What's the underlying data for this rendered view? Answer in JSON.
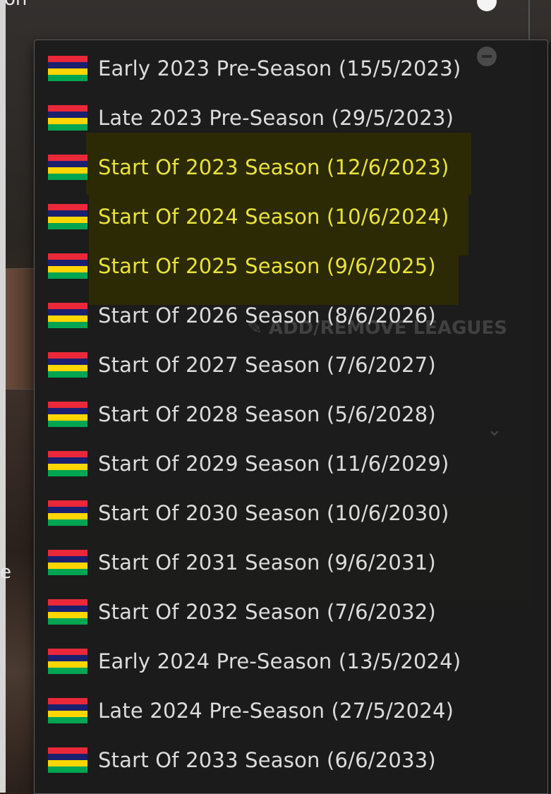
{
  "background": {
    "top_text": "on",
    "side_text": "e",
    "add_remove_label": "✎ ADD/REMOVE LEAGUES",
    "chevron": "⌄"
  },
  "menu": {
    "flag_colors": [
      "#ea2839",
      "#1a206d",
      "#ffd500",
      "#00a551"
    ],
    "highlight_color": "#e8e33a",
    "items": [
      {
        "label": "Early 2023 Pre-Season (15/5/2023)",
        "highlighted": false
      },
      {
        "label": "Late 2023 Pre-Season (29/5/2023)",
        "highlighted": false
      },
      {
        "label": "Start Of 2023 Season (12/6/2023)",
        "highlighted": true
      },
      {
        "label": "Start Of 2024 Season (10/6/2024)",
        "highlighted": true
      },
      {
        "label": "Start Of 2025 Season (9/6/2025)",
        "highlighted": true
      },
      {
        "label": "Start Of 2026 Season (8/6/2026)",
        "highlighted": false
      },
      {
        "label": "Start Of 2027 Season (7/6/2027)",
        "highlighted": false
      },
      {
        "label": "Start Of 2028 Season (5/6/2028)",
        "highlighted": false
      },
      {
        "label": "Start Of 2029 Season (11/6/2029)",
        "highlighted": false
      },
      {
        "label": "Start Of 2030 Season (10/6/2030)",
        "highlighted": false
      },
      {
        "label": "Start Of 2031 Season (9/6/2031)",
        "highlighted": false
      },
      {
        "label": "Start Of 2032 Season (7/6/2032)",
        "highlighted": false
      },
      {
        "label": "Early 2024 Pre-Season (13/5/2024)",
        "highlighted": false
      },
      {
        "label": "Late 2024 Pre-Season (27/5/2024)",
        "highlighted": false
      },
      {
        "label": "Start Of 2033 Season (6/6/2033)",
        "highlighted": false
      }
    ]
  }
}
